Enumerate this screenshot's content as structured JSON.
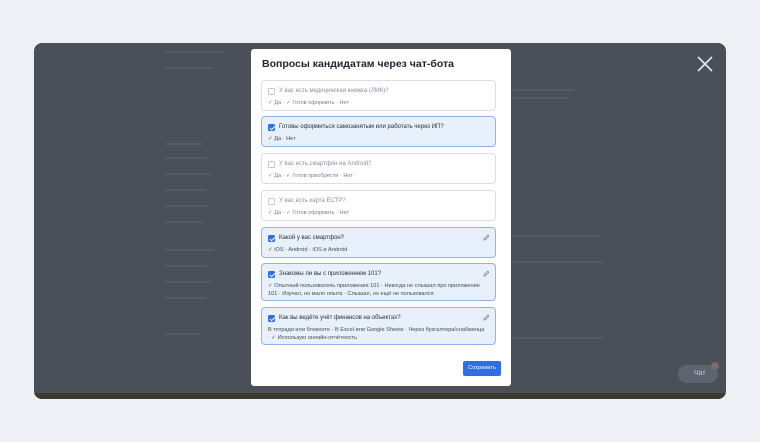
{
  "modal": {
    "title": "Вопросы кандидатам через чат-бота",
    "save_label": "Сохранить"
  },
  "questions": [
    {
      "text": "У вас есть медицинская книжка (ЛМК)?",
      "answers": "✓ Да · ✓ Готов оформить · Нет",
      "checked": false
    },
    {
      "text": "Готовы оформиться самозанятым или работать через ИП?",
      "answers": "✓ Да · Нет",
      "checked": true
    },
    {
      "text": "У вас есть смартфон на Android?",
      "answers": "✓ Да · ✓ Готов приобрести · Нет",
      "checked": false
    },
    {
      "text": "У вас есть карта ЕСТР?",
      "answers": "✓ Да · ✓ Готов оформить · Нет",
      "checked": false
    },
    {
      "text": "Какой у вас смартфон?",
      "answers": "✓ iOS · Android · iOS и Android",
      "checked": true
    },
    {
      "text": "Знакомы ли вы с приложением 101?",
      "answers": "✓ Опытный пользователь приложения 101 · Никогда не слышал про приложение 101 · Изучал, но мало опыта · Слышал, но ещё не пользовался",
      "checked": true
    },
    {
      "text": "Как вы ведёте учёт финансов на объектах?",
      "answers": "В тетради или блокноте · В Excel или Google Sheets · Через бухгалтера/снабженца · ✓ Использую онлайн-отчётность",
      "checked": true
    }
  ],
  "chat": {
    "label": "Чат"
  },
  "icons": {
    "close": "close-icon",
    "edit": "pencil-icon",
    "check": "checkbox-check-icon"
  },
  "colors": {
    "accent": "#2f6fe0",
    "overlay": "#4a4f58",
    "active_card": "#e8f0fb"
  }
}
